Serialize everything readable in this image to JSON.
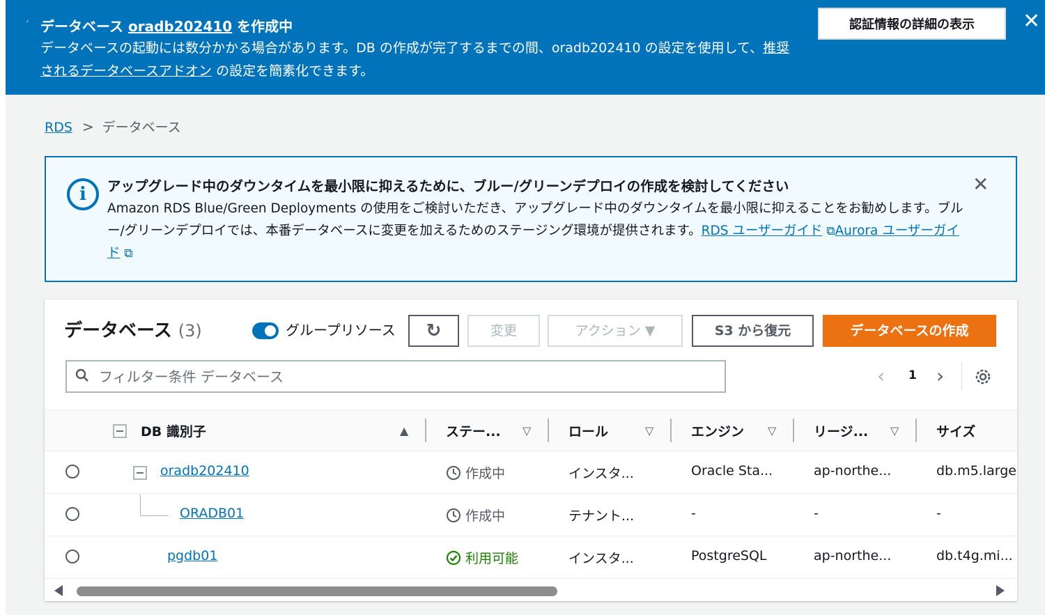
{
  "flash": {
    "title_prefix": "データベース",
    "db_name": "oradb202410",
    "title_suffix": "を作成中",
    "body_text": "データベースの起動には数分かかる場合があります。DB の作成が完了するまでの間、oradb202410 の設定を使用して、",
    "body_link": "推奨されるデータベースアドオン",
    "body_tail": "の設定を簡素化できます。",
    "button_label": "認証情報の詳細の表示"
  },
  "breadcrumb": {
    "root": "RDS",
    "current": "データベース"
  },
  "info": {
    "title": "アップグレード中のダウンタイムを最小限に抑えるために、ブルー/グリーンデプロイの作成を検討してください",
    "message": "Amazon RDS Blue/Green Deployments の使用をご検討いただき、アップグレード中のダウンタイムを最小限に抑えることをお勧めします。ブルー/グリーンデプロイでは、本番データベースに変更を加えるためのステージング環境が提供されます。",
    "link1": "RDS ユーザーガイド",
    "link2": "Aurora ユーザーガイド"
  },
  "panel": {
    "title": "データベース",
    "count": "(3)",
    "toggle_label": "グループリソース",
    "buttons": {
      "change": "変更",
      "actions": "アクション ▼",
      "restore_s3": "S3 から復元",
      "create": "データベースの作成"
    },
    "search_placeholder": "フィルター条件 データベース",
    "page": "1"
  },
  "table": {
    "headers": [
      "DB 識別子",
      "ステー...",
      "ロール",
      "エンジン",
      "リージ...",
      "サイズ"
    ],
    "rows": [
      {
        "id": "oradb202410",
        "status": "作成中",
        "role": "インスタ...",
        "engine": "Oracle Sta...",
        "region": "ap-northe...",
        "size": "db.m5.large"
      },
      {
        "id": "ORADB01",
        "status": "作成中",
        "role": "テナント...",
        "engine": "-",
        "region": "-",
        "size": "-"
      },
      {
        "id": "pgdb01",
        "status": "利用可能",
        "role": "インスタ...",
        "engine": "PostgreSQL",
        "region": "ap-northe...",
        "size": "db.t4g.mi..."
      }
    ]
  },
  "colors": {
    "brand_blue": "#0073bb",
    "primary_orange": "#ec7211",
    "success_green": "#1d8102"
  }
}
